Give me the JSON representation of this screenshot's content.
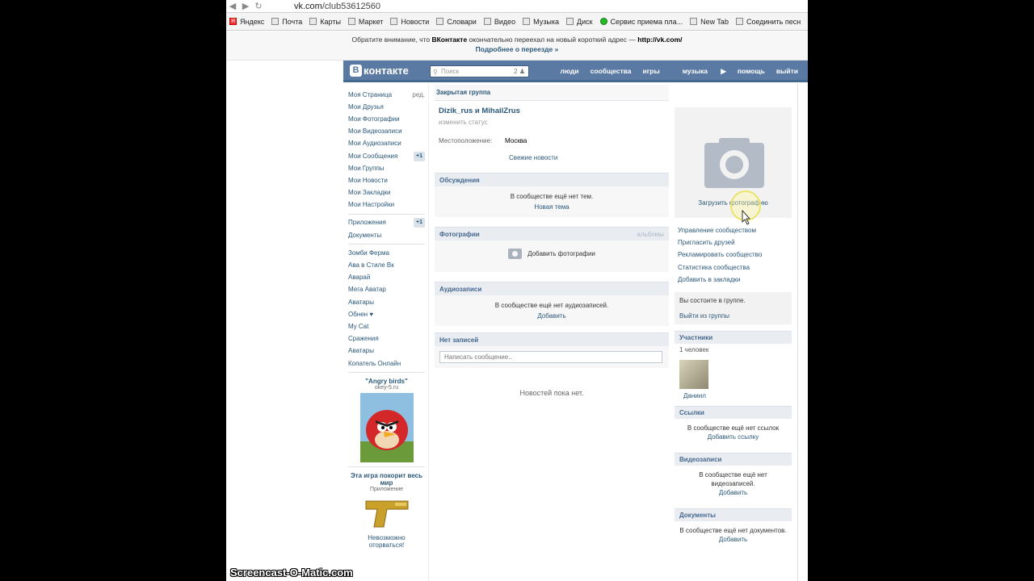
{
  "browser": {
    "url_host": "vk.com",
    "url_path": "/club53612560",
    "bookmarks": [
      "Яндекс",
      "Почта",
      "Карты",
      "Маркет",
      "Новости",
      "Словари",
      "Видео",
      "Музыка",
      "Диск",
      "Сервис приема пла...",
      "New Tab",
      "Соединить песн"
    ]
  },
  "notice": {
    "line1_a": "Обратите внимание, что ",
    "line1_b": "ВКонтакте",
    "line1_c": " окончательно переехал на новый короткий адрес — ",
    "line1_d": "http://vk.com/",
    "line2": "Подробнее о переезде »"
  },
  "header": {
    "logo": "контакте",
    "search_placeholder": "Поиск",
    "search_count": "2",
    "nav": [
      "люди",
      "сообщества",
      "игры",
      "музыка",
      "помощь",
      "выйти"
    ]
  },
  "left_menu": {
    "items": [
      {
        "label": "Моя Страница",
        "extra": "ред."
      },
      {
        "label": "Мои Друзья",
        "extra": ""
      },
      {
        "label": "Мои Фотографии",
        "extra": ""
      },
      {
        "label": "Мои Видеозаписи",
        "extra": ""
      },
      {
        "label": "Мои Аудиозаписи",
        "extra": ""
      },
      {
        "label": "Мои Сообщения",
        "extra": "+1"
      },
      {
        "label": "Мои Группы",
        "extra": ""
      },
      {
        "label": "Мои Новости",
        "extra": ""
      },
      {
        "label": "Мои Закладки",
        "extra": ""
      },
      {
        "label": "Мои Настройки",
        "extra": ""
      }
    ],
    "items2": [
      {
        "label": "Приложения",
        "extra": "+1"
      },
      {
        "label": "Документы",
        "extra": ""
      }
    ],
    "apps": [
      "Зомби Ферма",
      "Ава в Стиле Вк",
      "Аварай",
      "Мега Аватар",
      "Аватары",
      "Обнен ♥",
      "My Cat",
      "Сражения",
      "Аватары",
      "Копатель Онлайн"
    ],
    "ad1_title": "\"Angry birds\"",
    "ad1_sub": "okey-5.ru",
    "ad2_title": "Эта игра покорит весь мир",
    "ad2_sub": "Приложение",
    "ad2_text": "Невозможно оторваться!"
  },
  "group": {
    "type": "Закрытая группа",
    "name": "Dizik_rus и MihailZrus",
    "status": "изменить статус",
    "location_label": "Местоположение:",
    "location_value": "Москва",
    "fresh_news": "Свежие новости",
    "discussions_title": "Обсуждения",
    "discussions_empty": "В сообществе ещё нет тем.",
    "discussions_new": "Новая тема",
    "photos_title": "Фотографии",
    "photos_albums": "альбомы",
    "photos_add": "Добавить фотографии",
    "audio_title": "Аудиозаписи",
    "audio_empty": "В сообществе ещё нет аудиозаписей.",
    "audio_add": "Добавить",
    "wall_title": "Нет записей",
    "wall_placeholder": "Написать сообщение..",
    "no_news": "Новостей пока нет."
  },
  "right": {
    "upload_photo": "Загрузить фотографию",
    "actions": [
      "Управление сообществом",
      "Пригласить друзей",
      "Рекламировать сообщество",
      "Статистика сообщества",
      "Добавить в закладки"
    ],
    "member_text": "Вы состоите в группе.",
    "leave": "Выйти из группы",
    "members_title": "Участники",
    "members_count": "1 человек",
    "member_name": "Даниил",
    "links_title": "Ссылки",
    "links_empty": "В сообществе ещё нет ссылок",
    "links_add": "Добавить ссылку",
    "videos_title": "Видеозаписи",
    "videos_empty": "В сообществе ещё нет видеозаписей.",
    "videos_add": "Добавить",
    "docs_title": "Документы",
    "docs_empty": "В сообществе ещё нет документов.",
    "docs_add": "Добавить"
  },
  "watermark": "Screencast-O-Matic.com"
}
